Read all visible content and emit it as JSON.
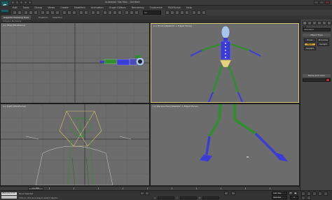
{
  "app": {
    "logo_letter": "S",
    "title": "Autodesk 3ds Max - Untitled"
  },
  "menubar": {
    "items": [
      "Edit",
      "Tools",
      "Group",
      "Views",
      "Create",
      "Modifiers",
      "Animation",
      "Graph Editors",
      "Rendering",
      "Customize",
      "MAXScript",
      "Help"
    ]
  },
  "toolbar": {
    "selection_filter": "All"
  },
  "ribbon": {
    "tabs": [
      "Graphite Modeling Tools",
      "Freeform",
      "Selection"
    ],
    "sub_label": "Polygon Modeling"
  },
  "viewports": {
    "top_left": {
      "label": "[+] [Top] [Wireframe]"
    },
    "top_right": {
      "label": "[+] [Front] [Realistic + Edged Faces]"
    },
    "bottom_left": {
      "label": "[+] [Left] [Wireframe]"
    },
    "bottom_right": {
      "label": "[+] [Perspective] [Realistic + Edged Faces]"
    }
  },
  "command_panel": {
    "category": "Standard",
    "rollout_object_type": "Object Type",
    "buttons": [
      "Bones",
      "Ring Array",
      "Biped",
      "Sunlight",
      "Daylight"
    ],
    "rollout_name": "Name and Color",
    "name_value": ""
  },
  "timeline": {
    "frame_display": "0 / 100",
    "ticks": [
      "0",
      "10",
      "20",
      "30",
      "40",
      "50",
      "60",
      "70",
      "80",
      "90",
      "100"
    ]
  },
  "status": {
    "listener_text": "Welcome to M",
    "prompt": "None Selected",
    "hint": "Click or click-and-drag to select objects",
    "x_label": "X:",
    "y_label": "Y:",
    "z_label": "Z:",
    "x_value": "",
    "y_value": "",
    "z_value": "",
    "autokey": "Auto Key",
    "autokey_mode": "Selected",
    "current_frame": "0"
  },
  "colors": {
    "viewport_bg": "#6c6c6c",
    "active_border": "#d9c47c",
    "bone_green": "#2f8f2f",
    "bone_blue": "#3b3bd8",
    "head_blue": "#a8c4e8"
  }
}
